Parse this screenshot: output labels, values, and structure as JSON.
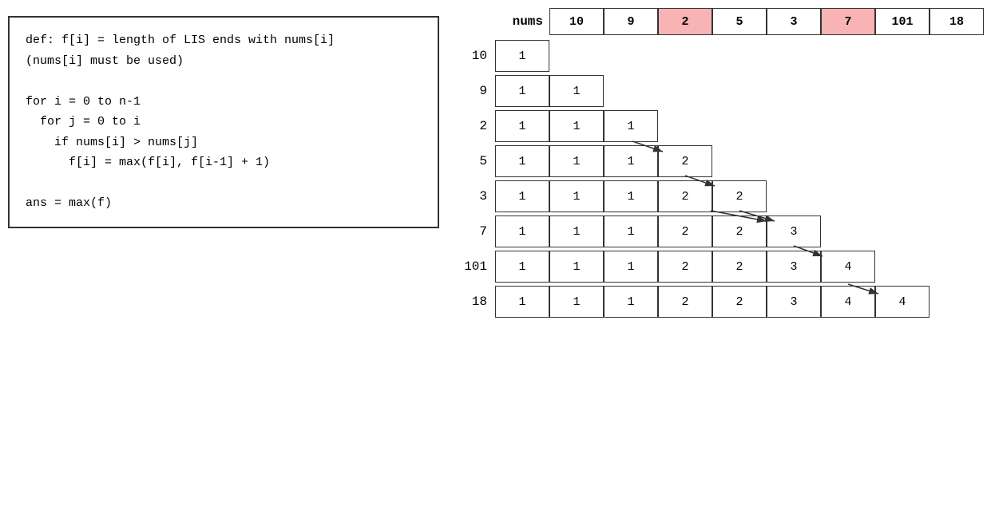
{
  "code": {
    "lines": [
      "def: f[i] = length of LIS ends with nums[i]",
      "(nums[i] must be used)",
      "",
      "for i = 0 to n-1",
      "  for j = 0 to i",
      "    if nums[i] > nums[j]",
      "      f[i] = max(f[i], f[i-1] + 1)",
      "",
      "ans = max(f)"
    ]
  },
  "header": {
    "label": "nums",
    "cells": [
      {
        "value": "10",
        "highlighted": false
      },
      {
        "value": "9",
        "highlighted": false
      },
      {
        "value": "2",
        "highlighted": true
      },
      {
        "value": "5",
        "highlighted": false
      },
      {
        "value": "3",
        "highlighted": false
      },
      {
        "value": "7",
        "highlighted": true
      },
      {
        "value": "101",
        "highlighted": false
      },
      {
        "value": "18",
        "highlighted": false
      }
    ]
  },
  "rows": [
    {
      "label": "10",
      "cells": [
        1
      ]
    },
    {
      "label": "9",
      "cells": [
        1,
        1
      ]
    },
    {
      "label": "2",
      "cells": [
        1,
        1,
        1
      ]
    },
    {
      "label": "5",
      "cells": [
        1,
        1,
        1,
        2
      ]
    },
    {
      "label": "3",
      "cells": [
        1,
        1,
        1,
        2,
        2
      ]
    },
    {
      "label": "7",
      "cells": [
        1,
        1,
        1,
        2,
        2,
        3
      ]
    },
    {
      "label": "101",
      "cells": [
        1,
        1,
        1,
        2,
        2,
        3,
        4
      ]
    },
    {
      "label": "18",
      "cells": [
        1,
        1,
        1,
        2,
        2,
        3,
        4,
        4
      ]
    }
  ]
}
